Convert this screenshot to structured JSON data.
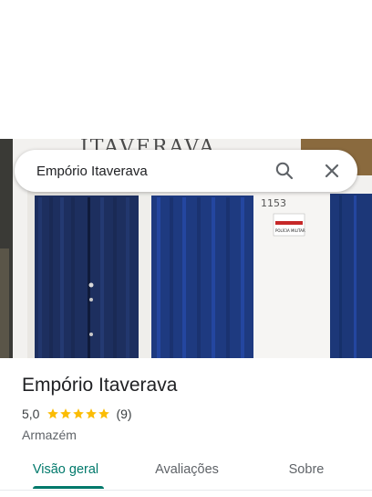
{
  "search": {
    "value": "Empório Itaverava"
  },
  "photo": {
    "sign_text": "ITAVERAVA",
    "address_number": "1153",
    "notice_text": "POLÍCIA MILITAR"
  },
  "place": {
    "name": "Empório Itaverava",
    "rating": "5,0",
    "stars": 5,
    "reviews_count": "(9)",
    "category": "Armazém"
  },
  "tabs": [
    {
      "label": "Visão geral",
      "active": true
    },
    {
      "label": "Avaliações",
      "active": false
    },
    {
      "label": "Sobre",
      "active": false
    }
  ],
  "colors": {
    "accent": "#00796b",
    "star": "#fbbc04",
    "door": "#1c3778"
  },
  "icons": [
    "search-icon",
    "close-icon",
    "star-icon"
  ]
}
